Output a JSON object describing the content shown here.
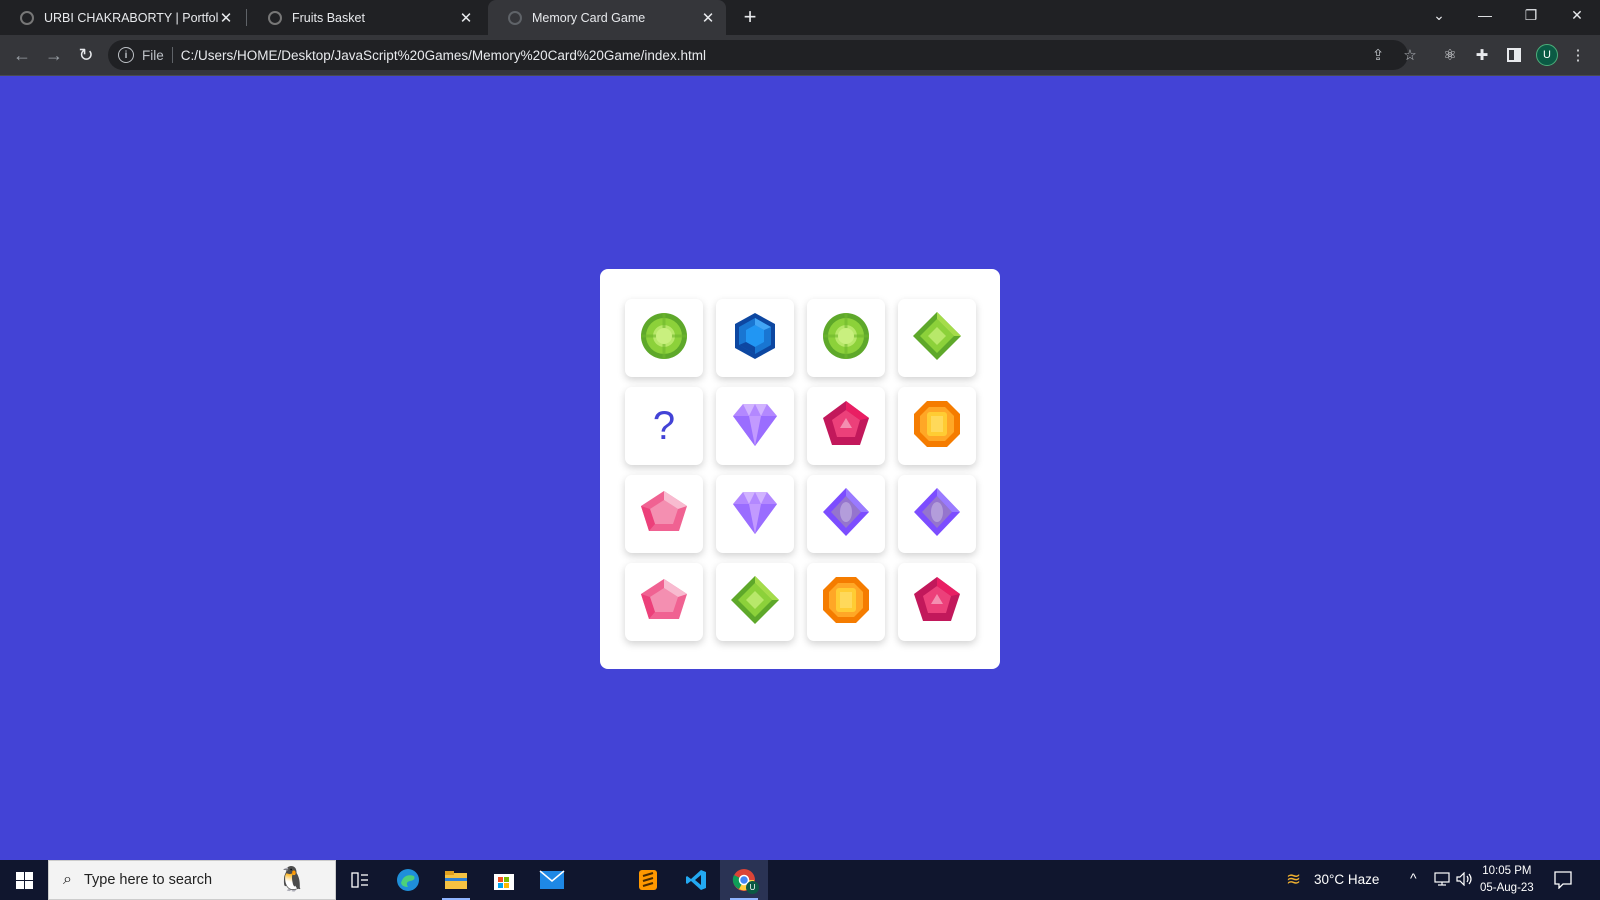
{
  "browser": {
    "tabs": [
      {
        "title": "URBI CHAKRABORTY | Portfolio"
      },
      {
        "title": "Fruits Basket"
      },
      {
        "title": "Memory Card Game",
        "active": true
      }
    ],
    "omnibox": {
      "scheme_label": "File",
      "url": "C:/Users/HOME/Desktop/JavaScript%20Games/Memory%20Card%20Game/index.html"
    },
    "profile_initial": "U"
  },
  "game": {
    "hidden_card_symbol": "?",
    "cards": [
      {
        "gem": "green-round",
        "revealed": true
      },
      {
        "gem": "blue-hexagon",
        "revealed": true
      },
      {
        "gem": "green-round",
        "revealed": true
      },
      {
        "gem": "green-diamond",
        "revealed": true
      },
      {
        "gem": "hidden",
        "revealed": false
      },
      {
        "gem": "purple-diamond",
        "revealed": true
      },
      {
        "gem": "red-pentagon",
        "revealed": true
      },
      {
        "gem": "orange-octagon",
        "revealed": true
      },
      {
        "gem": "pink-pentagon",
        "revealed": true
      },
      {
        "gem": "purple-diamond",
        "revealed": true
      },
      {
        "gem": "violet-rhombus",
        "revealed": true
      },
      {
        "gem": "violet-rhombus",
        "revealed": true
      },
      {
        "gem": "pink-pentagon",
        "revealed": true
      },
      {
        "gem": "green-diamond",
        "revealed": true
      },
      {
        "gem": "orange-octagon",
        "revealed": true
      },
      {
        "gem": "red-pentagon",
        "revealed": true
      }
    ]
  },
  "taskbar": {
    "search_placeholder": "Type here to search",
    "weather": "30°C  Haze",
    "time": "10:05 PM",
    "date": "05-Aug-23",
    "chrome_badge": "U"
  },
  "colors": {
    "page_background": "#4343d6",
    "question_mark": "#4343d6"
  }
}
